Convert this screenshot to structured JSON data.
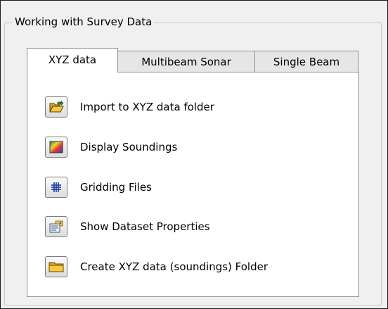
{
  "group": {
    "title": "Working with Survey Data"
  },
  "tabs": [
    {
      "label": "XYZ data",
      "selected": true
    },
    {
      "label": "Multibeam Sonar",
      "selected": false
    },
    {
      "label": "Single Beam",
      "selected": false
    }
  ],
  "actions": [
    {
      "label": "Import to XYZ data folder",
      "icon": "folder-open-icon"
    },
    {
      "label": "Display Soundings",
      "icon": "color-gradient-icon"
    },
    {
      "label": "Gridding Files",
      "icon": "grid-icon"
    },
    {
      "label": "Show Dataset Properties",
      "icon": "dataset-properties-icon"
    },
    {
      "label": "Create XYZ data (soundings) Folder",
      "icon": "folder-icon"
    }
  ],
  "colors": {
    "window_bg": "#f0f0f0",
    "panel_bg": "#ffffff",
    "folder_yellow": "#f5c842",
    "grid_blue": "#1f3f9e"
  }
}
